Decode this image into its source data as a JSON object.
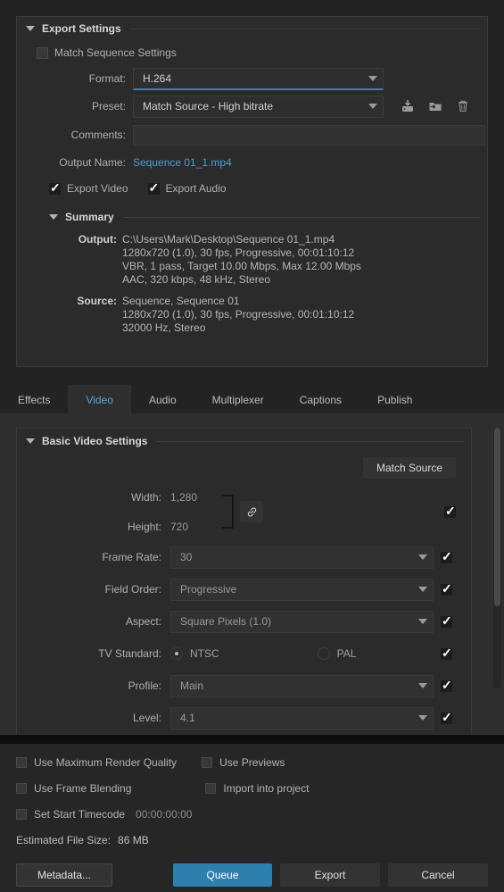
{
  "colors": {
    "accent": "#2d7fad",
    "link": "#4a9fd4",
    "tab_active_text": "#57a6de",
    "panel_bg": "#2b2b2b",
    "app_bg": "#232323",
    "bottom_bg": "#262626"
  },
  "export_settings": {
    "title": "Export Settings",
    "match_sequence_settings": {
      "label": "Match Sequence Settings",
      "checked": false
    },
    "format": {
      "label": "Format:",
      "value": "H.264"
    },
    "preset": {
      "label": "Preset:",
      "value": "Match Source - High bitrate",
      "icons": [
        "save-preset-icon",
        "import-preset-icon",
        "delete-preset-icon"
      ]
    },
    "comments": {
      "label": "Comments:",
      "value": "",
      "placeholder": ""
    },
    "output_name": {
      "label": "Output Name:",
      "value": "Sequence 01_1.mp4"
    },
    "export_video": {
      "label": "Export Video",
      "checked": true
    },
    "export_audio": {
      "label": "Export Audio",
      "checked": true
    },
    "summary": {
      "title": "Summary",
      "output_key": "Output:",
      "output_lines": [
        "C:\\Users\\Mark\\Desktop\\Sequence 01_1.mp4",
        "1280x720 (1.0), 30 fps, Progressive, 00:01:10:12",
        "VBR, 1 pass, Target 10.00 Mbps, Max 12.00 Mbps",
        "AAC, 320 kbps, 48 kHz, Stereo"
      ],
      "source_key": "Source:",
      "source_lines": [
        "Sequence, Sequence 01",
        "1280x720 (1.0), 30 fps, Progressive, 00:01:10:12",
        "32000 Hz, Stereo"
      ]
    }
  },
  "tabs": [
    {
      "label": "Effects",
      "active": false
    },
    {
      "label": "Video",
      "active": true
    },
    {
      "label": "Audio",
      "active": false
    },
    {
      "label": "Multiplexer",
      "active": false
    },
    {
      "label": "Captions",
      "active": false
    },
    {
      "label": "Publish",
      "active": false
    }
  ],
  "video_settings": {
    "title": "Basic Video Settings",
    "match_source_button": "Match Source",
    "width": {
      "label": "Width:",
      "value": "1,280"
    },
    "height": {
      "label": "Height:",
      "value": "720"
    },
    "link_icon": "link-icon",
    "dimension_checkbox_checked": true,
    "frame_rate": {
      "label": "Frame Rate:",
      "value": "30",
      "checked": true
    },
    "field_order": {
      "label": "Field Order:",
      "value": "Progressive",
      "checked": true
    },
    "aspect": {
      "label": "Aspect:",
      "value": "Square Pixels (1.0)",
      "checked": true
    },
    "tv_standard": {
      "label": "TV Standard:",
      "options": [
        {
          "label": "NTSC",
          "selected": true
        },
        {
          "label": "PAL",
          "selected": false
        }
      ],
      "checked": true
    },
    "profile": {
      "label": "Profile:",
      "value": "Main",
      "checked": true
    },
    "level": {
      "label": "Level:",
      "value": "4.1",
      "checked": true
    }
  },
  "bottom": {
    "options": [
      {
        "label": "Use Maximum Render Quality",
        "checked": false
      },
      {
        "label": "Use Previews",
        "checked": false
      },
      {
        "label": "Use Frame Blending",
        "checked": false
      },
      {
        "label": "Import into project",
        "checked": false
      }
    ],
    "set_start_timecode": {
      "label": "Set Start Timecode",
      "checked": false,
      "value": "00:00:00:00"
    },
    "estimated_file_size_label": "Estimated File Size:",
    "estimated_file_size_value": "86 MB",
    "buttons": [
      {
        "label": "Metadata...",
        "primary": false
      },
      {
        "label": "Queue",
        "primary": true
      },
      {
        "label": "Export",
        "primary": false
      },
      {
        "label": "Cancel",
        "primary": false
      }
    ]
  }
}
